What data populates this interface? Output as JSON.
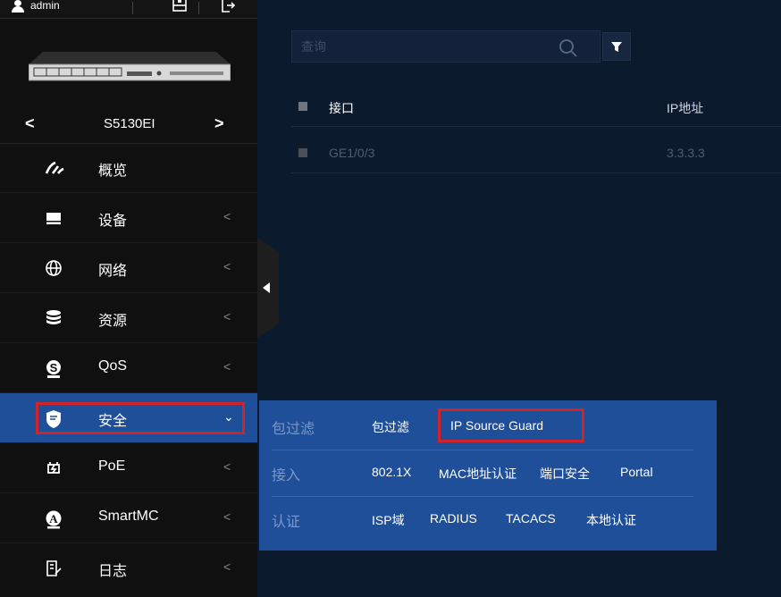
{
  "topbar": {
    "username": "admin"
  },
  "device": {
    "name": "S5130EI",
    "prev_arrow": "<",
    "next_arrow": ">"
  },
  "nav": {
    "items": [
      {
        "label": "概览",
        "arrow": ""
      },
      {
        "label": "设备",
        "arrow": "<"
      },
      {
        "label": "网络",
        "arrow": "<"
      },
      {
        "label": "资源",
        "arrow": "<"
      },
      {
        "label": "QoS",
        "arrow": "<"
      },
      {
        "label": "安全",
        "arrow": "⌄"
      },
      {
        "label": "PoE",
        "arrow": "<"
      },
      {
        "label": "SmartMC",
        "arrow": "<"
      },
      {
        "label": "日志",
        "arrow": "<"
      }
    ],
    "active": "安全"
  },
  "search": {
    "placeholder": "查询"
  },
  "table": {
    "headers": [
      "接口",
      "IP地址"
    ],
    "rows": [
      {
        "interface": "GE1/0/3",
        "ip": "3.3.3.3"
      }
    ]
  },
  "flyout": {
    "rows": [
      {
        "category": "包过滤",
        "links": [
          "包过滤",
          "IP Source Guard"
        ]
      },
      {
        "category": "接入",
        "links": [
          "802.1X",
          "MAC地址认证",
          "端口安全",
          "Portal"
        ]
      },
      {
        "category": "认证",
        "links": [
          "ISP域",
          "RADIUS",
          "TACACS",
          "本地认证"
        ]
      }
    ],
    "highlighted": "IP Source Guard"
  },
  "colors": {
    "sidebar_bg": "#101010",
    "main_bg": "#0c1a2e",
    "active_blue": "#1f4f99",
    "highlight_red": "#d3232a"
  },
  "icons": {
    "topbar": [
      "user-icon",
      "save-icon",
      "logout-icon"
    ],
    "nav": [
      "dashboard-icon",
      "device-icon",
      "globe-icon",
      "database-icon",
      "qos-icon",
      "shield-icon",
      "poe-icon",
      "smartmc-icon",
      "log-icon"
    ],
    "main": [
      "search-icon",
      "filter-icon"
    ]
  }
}
